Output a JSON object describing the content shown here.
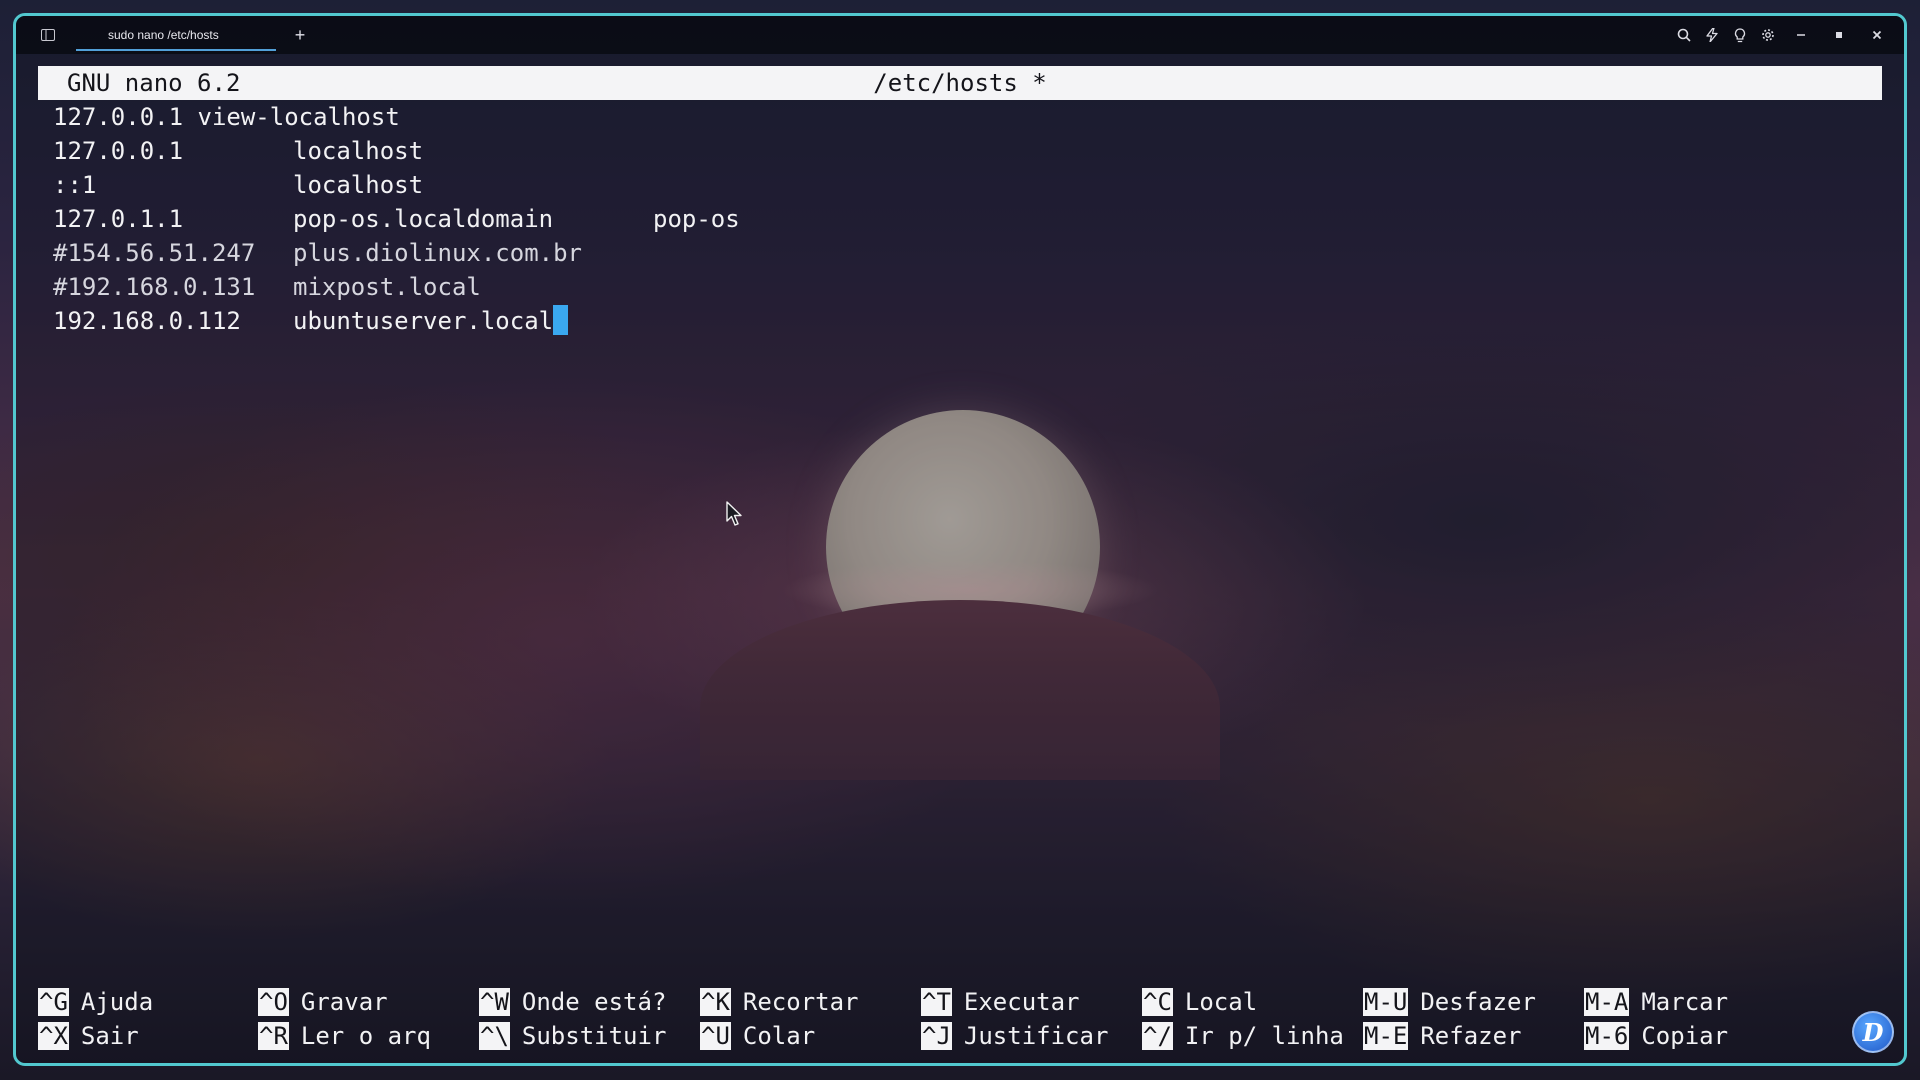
{
  "window": {
    "tab_title": "sudo nano /etc/hosts",
    "new_tab_symbol": "+",
    "accent": "#52c8cf"
  },
  "titlebar_icons": [
    "sidebar-icon",
    "search-icon",
    "bolt-icon",
    "lightbulb-icon",
    "gear-icon",
    "minimize-icon",
    "maximize-icon",
    "close-icon"
  ],
  "editor": {
    "app": "GNU nano 6.2",
    "file": "/etc/hosts *",
    "lines": [
      {
        "ip": "127.0.0.1 view-localhost",
        "host": "",
        "alias": ""
      },
      {
        "ip": "127.0.0.1",
        "host": "localhost",
        "alias": ""
      },
      {
        "ip": "::1",
        "host": "localhost",
        "alias": ""
      },
      {
        "ip": "127.0.1.1",
        "host": "pop-os.localdomain",
        "alias": "pop-os"
      },
      {
        "ip": "#154.56.51.247",
        "host": "plus.diolinux.com.br",
        "alias": ""
      },
      {
        "ip": "#192.168.0.131",
        "host": "mixpost.local",
        "alias": ""
      },
      {
        "ip": "192.168.0.112",
        "host": "ubuntuserver.local",
        "alias": ""
      }
    ],
    "cursor_color": "#3aa8f0"
  },
  "shortcuts": [
    {
      "key": "^G",
      "label": "Ajuda"
    },
    {
      "key": "^O",
      "label": "Gravar"
    },
    {
      "key": "^W",
      "label": "Onde está?"
    },
    {
      "key": "^K",
      "label": "Recortar"
    },
    {
      "key": "^T",
      "label": "Executar"
    },
    {
      "key": "^C",
      "label": "Local"
    },
    {
      "key": "M-U",
      "label": "Desfazer"
    },
    {
      "key": "M-A",
      "label": "Marcar"
    },
    {
      "key": "^X",
      "label": "Sair"
    },
    {
      "key": "^R",
      "label": "Ler o arq"
    },
    {
      "key": "^\\",
      "label": "Substituir"
    },
    {
      "key": "^U",
      "label": "Colar"
    },
    {
      "key": "^J",
      "label": "Justificar"
    },
    {
      "key": "^/",
      "label": "Ir p/ linha"
    },
    {
      "key": "M-E",
      "label": "Refazer"
    },
    {
      "key": "M-6",
      "label": "Copiar"
    }
  ],
  "badge": {
    "letter": "D"
  }
}
